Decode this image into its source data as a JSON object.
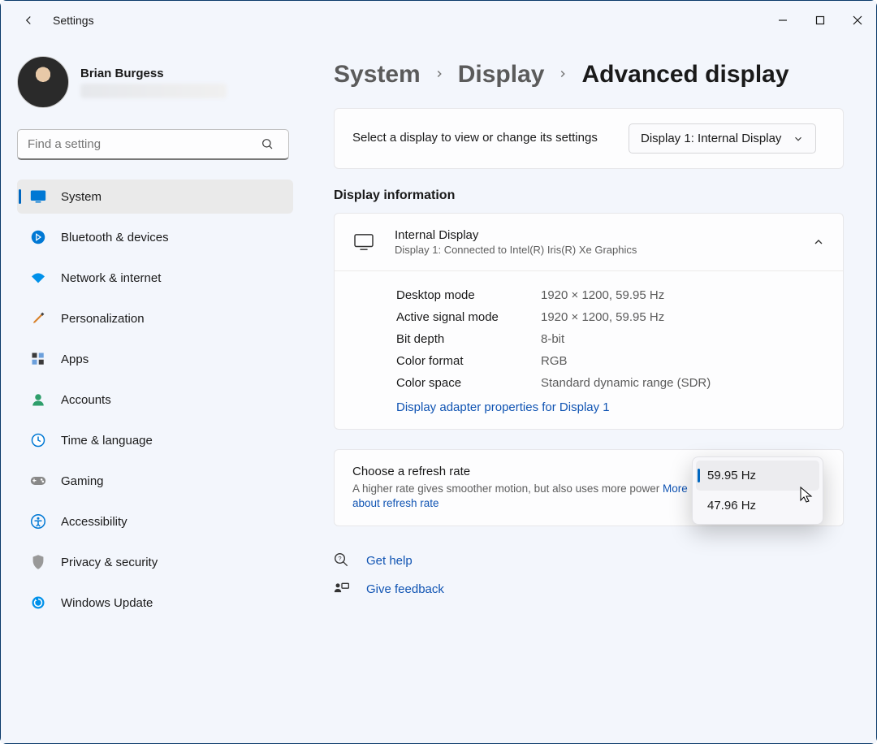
{
  "titlebar": {
    "title": "Settings"
  },
  "user": {
    "name": "Brian Burgess"
  },
  "search": {
    "placeholder": "Find a setting"
  },
  "nav": {
    "items": [
      {
        "label": "System"
      },
      {
        "label": "Bluetooth & devices"
      },
      {
        "label": "Network & internet"
      },
      {
        "label": "Personalization"
      },
      {
        "label": "Apps"
      },
      {
        "label": "Accounts"
      },
      {
        "label": "Time & language"
      },
      {
        "label": "Gaming"
      },
      {
        "label": "Accessibility"
      },
      {
        "label": "Privacy & security"
      },
      {
        "label": "Windows Update"
      }
    ]
  },
  "breadcrumbs": {
    "a": "System",
    "b": "Display",
    "c": "Advanced display"
  },
  "selectDisplay": {
    "label": "Select a display to view or change its settings",
    "value": "Display 1: Internal Display"
  },
  "displayInfo": {
    "sectionTitle": "Display information",
    "name": "Internal Display",
    "sub": "Display 1: Connected to Intel(R) Iris(R) Xe Graphics",
    "rows": {
      "desktopMode_k": "Desktop mode",
      "desktopMode_v": "1920 × 1200, 59.95 Hz",
      "activeSignal_k": "Active signal mode",
      "activeSignal_v": "1920 × 1200, 59.95 Hz",
      "bitDepth_k": "Bit depth",
      "bitDepth_v": "8-bit",
      "colorFormat_k": "Color format",
      "colorFormat_v": "RGB",
      "colorSpace_k": "Color space",
      "colorSpace_v": "Standard dynamic range (SDR)"
    },
    "adapterLink": "Display adapter properties for Display 1"
  },
  "refresh": {
    "title": "Choose a refresh rate",
    "sub": "A higher rate gives smoother motion, but also uses more power  ",
    "link": "More about refresh rate",
    "options": [
      {
        "label": "59.95 Hz"
      },
      {
        "label": "47.96 Hz"
      }
    ]
  },
  "help": {
    "getHelp": "Get help",
    "feedback": "Give feedback"
  }
}
